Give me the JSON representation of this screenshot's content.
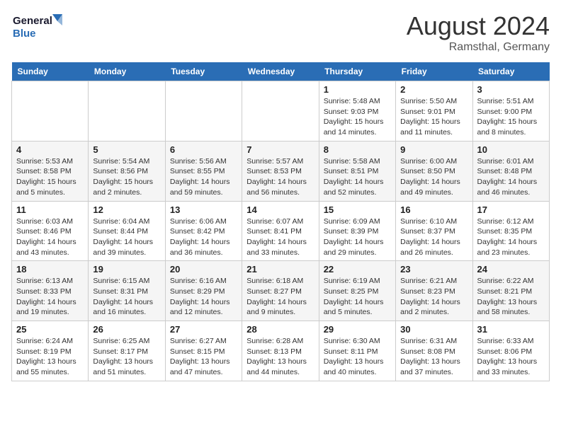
{
  "header": {
    "logo_line1": "General",
    "logo_line2": "Blue",
    "month_year": "August 2024",
    "location": "Ramsthal, Germany"
  },
  "weekdays": [
    "Sunday",
    "Monday",
    "Tuesday",
    "Wednesday",
    "Thursday",
    "Friday",
    "Saturday"
  ],
  "weeks": [
    [
      {
        "day": "",
        "info": ""
      },
      {
        "day": "",
        "info": ""
      },
      {
        "day": "",
        "info": ""
      },
      {
        "day": "",
        "info": ""
      },
      {
        "day": "1",
        "info": "Sunrise: 5:48 AM\nSunset: 9:03 PM\nDaylight: 15 hours and 14 minutes."
      },
      {
        "day": "2",
        "info": "Sunrise: 5:50 AM\nSunset: 9:01 PM\nDaylight: 15 hours and 11 minutes."
      },
      {
        "day": "3",
        "info": "Sunrise: 5:51 AM\nSunset: 9:00 PM\nDaylight: 15 hours and 8 minutes."
      }
    ],
    [
      {
        "day": "4",
        "info": "Sunrise: 5:53 AM\nSunset: 8:58 PM\nDaylight: 15 hours and 5 minutes."
      },
      {
        "day": "5",
        "info": "Sunrise: 5:54 AM\nSunset: 8:56 PM\nDaylight: 15 hours and 2 minutes."
      },
      {
        "day": "6",
        "info": "Sunrise: 5:56 AM\nSunset: 8:55 PM\nDaylight: 14 hours and 59 minutes."
      },
      {
        "day": "7",
        "info": "Sunrise: 5:57 AM\nSunset: 8:53 PM\nDaylight: 14 hours and 56 minutes."
      },
      {
        "day": "8",
        "info": "Sunrise: 5:58 AM\nSunset: 8:51 PM\nDaylight: 14 hours and 52 minutes."
      },
      {
        "day": "9",
        "info": "Sunrise: 6:00 AM\nSunset: 8:50 PM\nDaylight: 14 hours and 49 minutes."
      },
      {
        "day": "10",
        "info": "Sunrise: 6:01 AM\nSunset: 8:48 PM\nDaylight: 14 hours and 46 minutes."
      }
    ],
    [
      {
        "day": "11",
        "info": "Sunrise: 6:03 AM\nSunset: 8:46 PM\nDaylight: 14 hours and 43 minutes."
      },
      {
        "day": "12",
        "info": "Sunrise: 6:04 AM\nSunset: 8:44 PM\nDaylight: 14 hours and 39 minutes."
      },
      {
        "day": "13",
        "info": "Sunrise: 6:06 AM\nSunset: 8:42 PM\nDaylight: 14 hours and 36 minutes."
      },
      {
        "day": "14",
        "info": "Sunrise: 6:07 AM\nSunset: 8:41 PM\nDaylight: 14 hours and 33 minutes."
      },
      {
        "day": "15",
        "info": "Sunrise: 6:09 AM\nSunset: 8:39 PM\nDaylight: 14 hours and 29 minutes."
      },
      {
        "day": "16",
        "info": "Sunrise: 6:10 AM\nSunset: 8:37 PM\nDaylight: 14 hours and 26 minutes."
      },
      {
        "day": "17",
        "info": "Sunrise: 6:12 AM\nSunset: 8:35 PM\nDaylight: 14 hours and 23 minutes."
      }
    ],
    [
      {
        "day": "18",
        "info": "Sunrise: 6:13 AM\nSunset: 8:33 PM\nDaylight: 14 hours and 19 minutes."
      },
      {
        "day": "19",
        "info": "Sunrise: 6:15 AM\nSunset: 8:31 PM\nDaylight: 14 hours and 16 minutes."
      },
      {
        "day": "20",
        "info": "Sunrise: 6:16 AM\nSunset: 8:29 PM\nDaylight: 14 hours and 12 minutes."
      },
      {
        "day": "21",
        "info": "Sunrise: 6:18 AM\nSunset: 8:27 PM\nDaylight: 14 hours and 9 minutes."
      },
      {
        "day": "22",
        "info": "Sunrise: 6:19 AM\nSunset: 8:25 PM\nDaylight: 14 hours and 5 minutes."
      },
      {
        "day": "23",
        "info": "Sunrise: 6:21 AM\nSunset: 8:23 PM\nDaylight: 14 hours and 2 minutes."
      },
      {
        "day": "24",
        "info": "Sunrise: 6:22 AM\nSunset: 8:21 PM\nDaylight: 13 hours and 58 minutes."
      }
    ],
    [
      {
        "day": "25",
        "info": "Sunrise: 6:24 AM\nSunset: 8:19 PM\nDaylight: 13 hours and 55 minutes."
      },
      {
        "day": "26",
        "info": "Sunrise: 6:25 AM\nSunset: 8:17 PM\nDaylight: 13 hours and 51 minutes."
      },
      {
        "day": "27",
        "info": "Sunrise: 6:27 AM\nSunset: 8:15 PM\nDaylight: 13 hours and 47 minutes."
      },
      {
        "day": "28",
        "info": "Sunrise: 6:28 AM\nSunset: 8:13 PM\nDaylight: 13 hours and 44 minutes."
      },
      {
        "day": "29",
        "info": "Sunrise: 6:30 AM\nSunset: 8:11 PM\nDaylight: 13 hours and 40 minutes."
      },
      {
        "day": "30",
        "info": "Sunrise: 6:31 AM\nSunset: 8:08 PM\nDaylight: 13 hours and 37 minutes."
      },
      {
        "day": "31",
        "info": "Sunrise: 6:33 AM\nSunset: 8:06 PM\nDaylight: 13 hours and 33 minutes."
      }
    ]
  ]
}
